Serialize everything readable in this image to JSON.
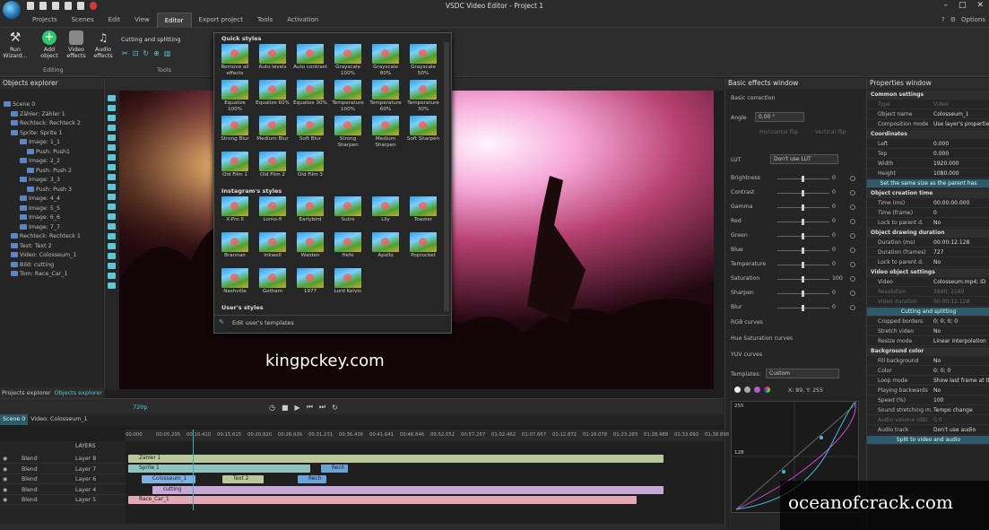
{
  "app": {
    "title": "VSDC Video Editor - Project 1"
  },
  "menu": {
    "items": [
      "Projects",
      "Scenes",
      "Edit",
      "View",
      "Editor",
      "Export project",
      "Tools",
      "Activation"
    ],
    "active": "Editor",
    "options": "Options"
  },
  "ribbon": {
    "run_wizard": "Run Wizard...",
    "add_object": "Add object",
    "video_effects": "Video effects",
    "audio_effects": "Audio effects",
    "editing_group": "Editing",
    "cutting": "Cutting and splitting",
    "tools_group": "Tools"
  },
  "objects_explorer": {
    "title": "Objects explorer",
    "items": [
      "Scene 0",
      "Zähler: Zähler 1",
      "Rechteck: Rechteck 2",
      "Sprite: Sprite 1",
      "Image: 1_1",
      "Push: Push1",
      "Image: 2_2",
      "Push: Push 2",
      "Image: 3_3",
      "Push: Push 3",
      "Image: 4_4",
      "Image: 5_5",
      "Image: 6_6",
      "Image: 7_7",
      "Rechteck: Rechteck 1",
      "Text: Text 2",
      "Video: Colosseum_1",
      "Bild: cutting",
      "Tom: Race_Car_1"
    ],
    "tabs": [
      "Projects explorer",
      "Objects explorer"
    ]
  },
  "effects_popup": {
    "quick_header": "Quick styles",
    "quick": [
      "Remove all effects",
      "Auto levels",
      "Auto contrast",
      "Grayscale 100%",
      "Grayscale 80%",
      "Grayscale 50%",
      "Equalize 100%",
      "Equalize 60%",
      "Equalize 30%",
      "Temperature 100%",
      "Temperature 60%",
      "Temperature 30%",
      "Strong Blur",
      "Medium Blur",
      "Soft Blur",
      "Strong Sharpen",
      "Medium Sharpen",
      "Soft Sharpen",
      "Old Film 1",
      "Old Film 2",
      "Old Film 3"
    ],
    "instagram_header": "Instagram's styles",
    "instagram": [
      "X-Pro II",
      "Lomo-fi",
      "Earlybird",
      "Sutro",
      "Lily",
      "Toaster",
      "Brannan",
      "Inkwell",
      "Walden",
      "Hefe",
      "Apollo",
      "Poprocket",
      "Nashville",
      "Gotham",
      "1977",
      "Lord Kelvin"
    ],
    "user_header": "User's styles",
    "edit_templates": "Edit user's templates"
  },
  "watermarks": {
    "site1": "kingpckey.com",
    "site2": "oceanofcrack.com"
  },
  "basic_effects": {
    "title": "Basic effects window",
    "basic_correction": "Basic correction",
    "angle_label": "Angle",
    "angle_value": "0.00 °",
    "hflip": "Horizontal flip",
    "vflip": "Vertical flip",
    "lut_label": "LUT",
    "lut_value": "Don't use LUT",
    "sliders": [
      {
        "label": "Brightness",
        "value": "0"
      },
      {
        "label": "Contrast",
        "value": "0"
      },
      {
        "label": "Gamma",
        "value": "0"
      },
      {
        "label": "Red",
        "value": "0"
      },
      {
        "label": "Green",
        "value": "0"
      },
      {
        "label": "Blue",
        "value": "0"
      },
      {
        "label": "Temperature",
        "value": "0"
      },
      {
        "label": "Saturation",
        "value": "100"
      },
      {
        "label": "Sharpen",
        "value": "0"
      },
      {
        "label": "Blur",
        "value": "0"
      }
    ],
    "rgb_curves": "RGB curves",
    "hue_curves": "Hue Saturation curves",
    "yuv_curves": "YUV curves",
    "templates_label": "Templates:",
    "templates_value": "Custom",
    "xy_readout": "X: 89, Y: 255",
    "curve_top": "255",
    "curve_mid": "128"
  },
  "properties": {
    "title": "Properties window",
    "rows": [
      {
        "k": "Common settings",
        "type": "sec"
      },
      {
        "k": "Type",
        "v": "Video",
        "type": "dim"
      },
      {
        "k": "Object name",
        "v": "Colosseum_1"
      },
      {
        "k": "Composition mode",
        "v": "Use layer's properties"
      },
      {
        "k": "Coordinates",
        "type": "sec"
      },
      {
        "k": "Left",
        "v": "0.000"
      },
      {
        "k": "Top",
        "v": "0.000"
      },
      {
        "k": "Width",
        "v": "1920.000"
      },
      {
        "k": "Height",
        "v": "1080.000"
      },
      {
        "k": "Set the same size as the parent has",
        "type": "btn"
      },
      {
        "k": "Object creation time",
        "type": "sec"
      },
      {
        "k": "Time (ms)",
        "v": "00:00:00.000"
      },
      {
        "k": "Time (frame)",
        "v": "0"
      },
      {
        "k": "Lock to parent d.",
        "v": "No"
      },
      {
        "k": "Object drawing duration",
        "type": "sec"
      },
      {
        "k": "Duration (ms)",
        "v": "00:00:12.128"
      },
      {
        "k": "Duration (frames)",
        "v": "727"
      },
      {
        "k": "Lock to parent d.",
        "v": "No"
      },
      {
        "k": "Video object settings",
        "type": "sec"
      },
      {
        "k": "Video",
        "v": "Colosseum.mp4; ID"
      },
      {
        "k": "Resolution",
        "v": "3840; 2160",
        "type": "dim"
      },
      {
        "k": "Video duration",
        "v": "00:00:12.128",
        "type": "dim"
      },
      {
        "k": "Cutting and splitting",
        "type": "btn"
      },
      {
        "k": "Cropped borders",
        "v": "0; 0; 0; 0"
      },
      {
        "k": "Stretch video",
        "v": "No"
      },
      {
        "k": "Resize mode",
        "v": "Linear interpolation"
      },
      {
        "k": "Background color",
        "type": "sec"
      },
      {
        "k": "Fill background",
        "v": "No"
      },
      {
        "k": "Color",
        "v": "0; 0; 0"
      },
      {
        "k": "Loop mode",
        "v": "Show last frame at the"
      },
      {
        "k": "Playing backwards",
        "v": "No"
      },
      {
        "k": "Speed (%)",
        "v": "100"
      },
      {
        "k": "Sound stretching m.",
        "v": "Tempo change"
      },
      {
        "k": "Audio volume (dB)",
        "v": "0.0",
        "type": "dim"
      },
      {
        "k": "Audio track",
        "v": "Don't use audio"
      },
      {
        "k": "Split to video and audio",
        "type": "btn"
      }
    ]
  },
  "timeline": {
    "resolution": "720p",
    "tabs": [
      "Scene 0",
      "Video: Colosseum_1"
    ],
    "layers_label": "LAYERS",
    "ruler": [
      "00:000",
      "00:05.205",
      "00:10.410",
      "00:15.615",
      "00:20.820",
      "00:26.026",
      "00:31.231",
      "00:36.436",
      "00:41.641",
      "00:46.846",
      "00:52.052",
      "00:57.257",
      "01:02.462",
      "01:07.667",
      "01:12.872",
      "01:18.078",
      "01:23.283",
      "01:28.488",
      "01:33.693",
      "01:38.898"
    ],
    "layers": [
      {
        "blend": "Blend",
        "name": "Layer 8"
      },
      {
        "blend": "Blend",
        "name": "Layer 7"
      },
      {
        "blend": "Blend",
        "name": "Layer 6"
      },
      {
        "blend": "Blend",
        "name": "Layer 4"
      },
      {
        "blend": "Blend",
        "name": "Layer 5"
      }
    ],
    "clips": {
      "zahler": "Zähler 1",
      "sprite": "Sprite 1",
      "rech1": "Rech",
      "colosseum": "Colosseum_1",
      "text": "Text 2",
      "rech2": "Rech",
      "cutting": "cutting",
      "race": "Race_Car_1"
    }
  },
  "colors": {
    "accent": "#2fb5c8",
    "panel": "#252525"
  }
}
